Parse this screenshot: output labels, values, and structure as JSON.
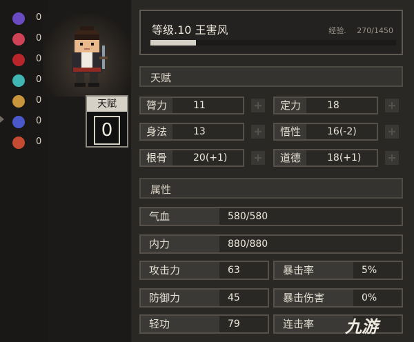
{
  "status_effects": [
    {
      "icon": "skull-icon",
      "value": "0",
      "color": "#6a4bc4"
    },
    {
      "icon": "broken-heart-icon",
      "value": "0",
      "color": "#d04255"
    },
    {
      "icon": "bleed-icon",
      "value": "0",
      "color": "#b8262c"
    },
    {
      "icon": "poison-icon",
      "value": "0",
      "color": "#3fb6b4"
    },
    {
      "icon": "stun-icon",
      "value": "0",
      "color": "#c9953c"
    },
    {
      "icon": "confusion-icon",
      "value": "0",
      "color": "#4a58c9"
    },
    {
      "icon": "burn-icon",
      "value": "0",
      "color": "#c44a32"
    }
  ],
  "talent_box": {
    "title": "天赋",
    "value": "0"
  },
  "header": {
    "name": "等级.10 王害风",
    "exp_label": "经验.",
    "exp_value": "270/1450",
    "exp_fraction": 0.186
  },
  "sections": {
    "talent": "天赋",
    "attributes": "属性"
  },
  "talents": [
    {
      "label": "膂力",
      "value": "11"
    },
    {
      "label": "定力",
      "value": "18"
    },
    {
      "label": "身法",
      "value": "13"
    },
    {
      "label": "悟性",
      "value": "16(-2)"
    },
    {
      "label": "根骨",
      "value": "20(+1)"
    },
    {
      "label": "道德",
      "value": "18(+1)"
    }
  ],
  "attributes": {
    "hp": {
      "label": "气血",
      "value": "580/580"
    },
    "mp": {
      "label": "内力",
      "value": "880/880"
    },
    "attack": {
      "label": "攻击力",
      "value": "63"
    },
    "crit_rate": {
      "label": "暴击率",
      "value": "5%"
    },
    "defense": {
      "label": "防御力",
      "value": "45"
    },
    "crit_damage": {
      "label": "暴击伤害",
      "value": "0%"
    },
    "agility": {
      "label": "轻功",
      "value": "79"
    },
    "combo_rate": {
      "label": "连击率",
      "value": ""
    }
  },
  "watermark": "九游"
}
